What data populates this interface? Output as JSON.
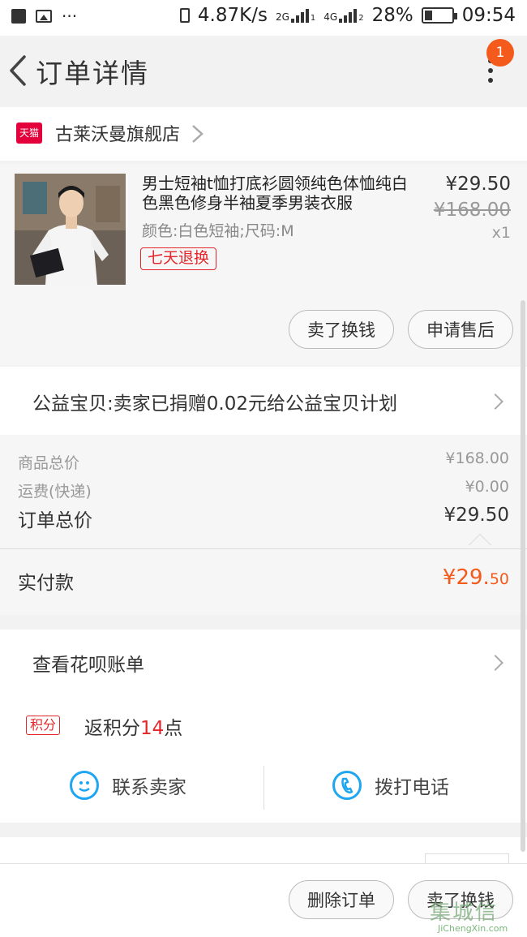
{
  "status_bar": {
    "more": "···",
    "net_speed": "4.87K/s",
    "sim1": "2G",
    "sim1_idx": "1",
    "sim2": "4G",
    "sim2_idx": "2",
    "battery": "28%",
    "battery_level": 0.28,
    "time": "09:54"
  },
  "header": {
    "title": "订单详情",
    "notification_count": "1"
  },
  "store": {
    "platform": "天猫",
    "name": "古莱沃曼旗舰店"
  },
  "product": {
    "name": "男士短袖t恤打底衫圆领纯色体恤纯白色黑色修身半袖夏季男装衣服",
    "spec": "颜色:白色短袖;尺码:M",
    "return_tag": "七天退换",
    "price": "¥29.50",
    "original_price": "¥168.00",
    "quantity": "x1",
    "actions": {
      "sell": "卖了换钱",
      "after_sale": "申请售后"
    }
  },
  "charity": {
    "text": "公益宝贝:卖家已捐赠0.02元给公益宝贝计划"
  },
  "summary": {
    "goods_total_label": "商品总价",
    "goods_total_value": "¥168.00",
    "shipping_label": "运费(快递)",
    "shipping_value": "¥0.00",
    "order_total_label": "订单总价",
    "order_total_value": "¥29.50",
    "paid_label": "实付款",
    "paid_int": "¥29.",
    "paid_dec": "50"
  },
  "huabei": {
    "label": "查看花呗账单"
  },
  "points": {
    "tag": "积分",
    "prefix": "返积分",
    "value": "14",
    "suffix": "点"
  },
  "contact": {
    "seller": "联系卖家",
    "call": "拨打电话"
  },
  "footer": {
    "delete": "删除订单",
    "sell": "卖了换钱"
  },
  "watermark": {
    "brand": "集城信",
    "url": "JiChengXin.com"
  },
  "colors": {
    "accent": "#f35a1b",
    "tmall_red": "#e4003a",
    "tag_red": "#e4262b",
    "link_blue": "#1fa6f0"
  }
}
